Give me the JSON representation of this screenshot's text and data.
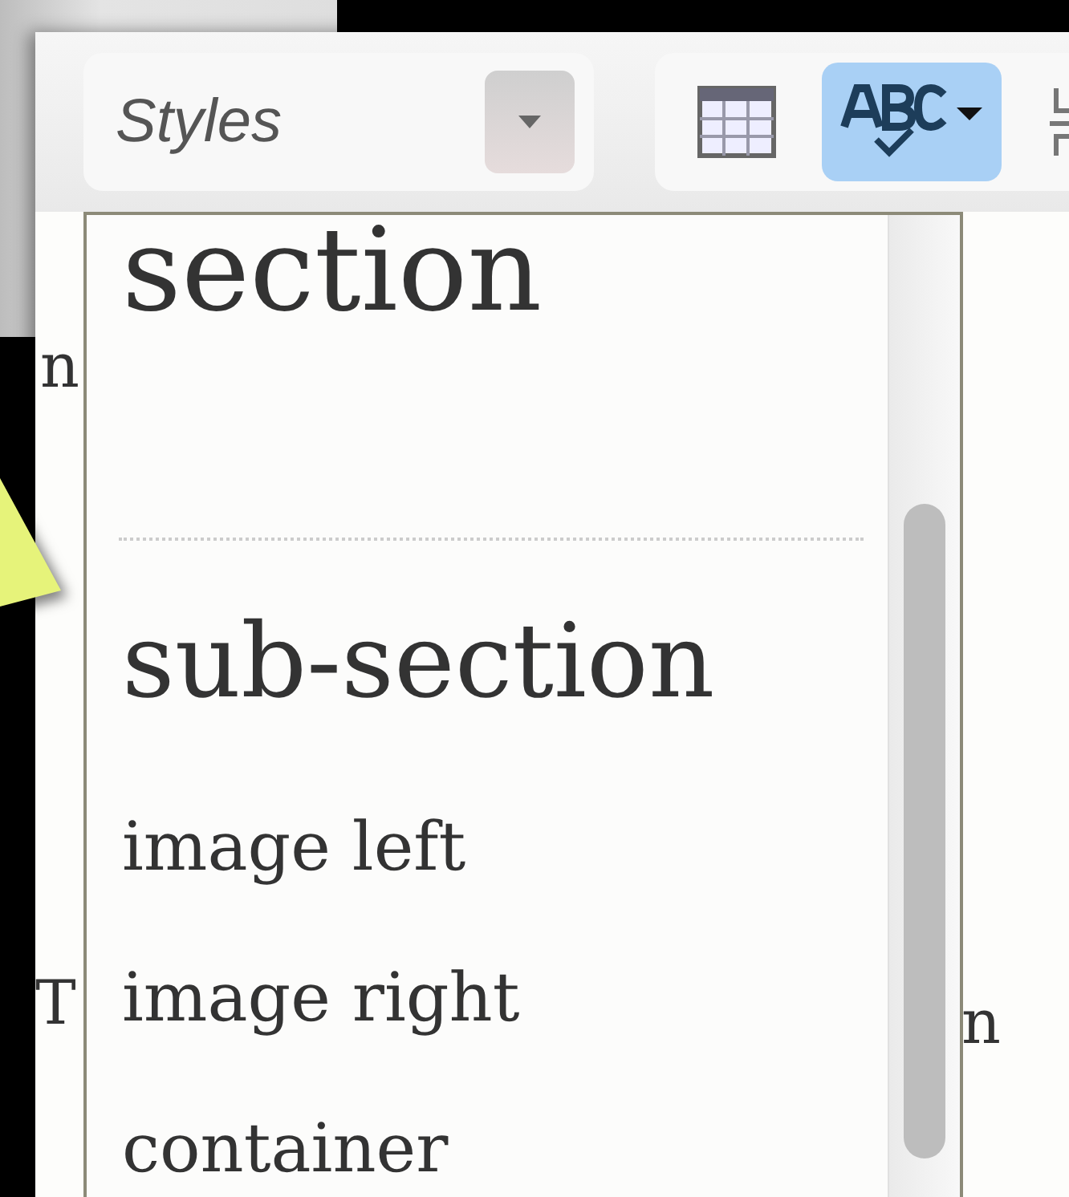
{
  "toolbar": {
    "styles_combo": {
      "label": "Styles"
    },
    "buttons": [
      {
        "kind": "table",
        "selected": false
      },
      {
        "kind": "spellcheck",
        "selected": true
      },
      {
        "kind": "pagebreak",
        "selected": false
      }
    ]
  },
  "editor_fragments": [
    "n",
    "T",
    "n"
  ],
  "styles_menu": {
    "items": [
      {
        "kind": "heading",
        "label": "section"
      },
      {
        "kind": "separator"
      },
      {
        "kind": "heading",
        "label": "sub-section"
      },
      {
        "kind": "item",
        "label": "image left"
      },
      {
        "kind": "item",
        "label": "image right"
      },
      {
        "kind": "item",
        "label": "container"
      }
    ]
  }
}
